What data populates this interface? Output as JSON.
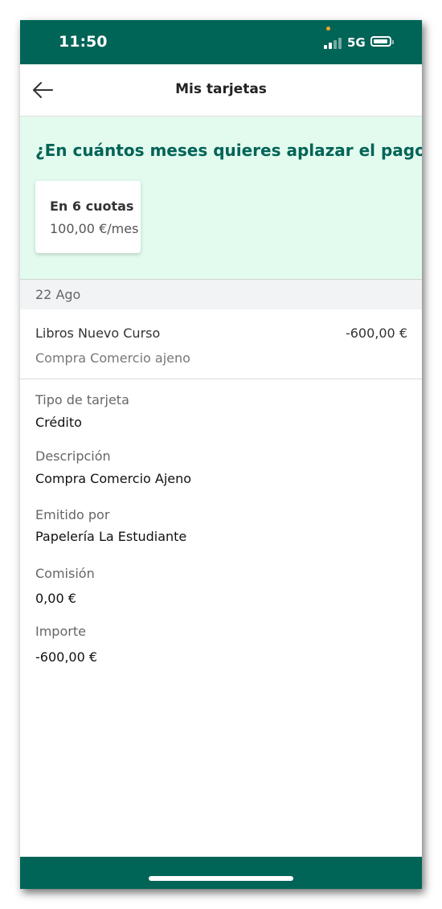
{
  "status": {
    "time": "11:50",
    "network": "5G"
  },
  "header": {
    "title": "Mis tarjetas",
    "back_icon": "arrow-left-icon"
  },
  "promo": {
    "question": "¿En cuántos meses quieres aplazar el pago?",
    "option": {
      "title": "En 6 cuotas",
      "amount": "100,00 €/mes"
    }
  },
  "transaction": {
    "date": "22 Ago",
    "name": "Libros Nuevo Curso",
    "amount": "-600,00 €",
    "type": "Compra Comercio ajeno"
  },
  "details": [
    {
      "label": "Tipo de tarjeta",
      "value": "Crédito"
    },
    {
      "label": "Descripción",
      "value": "Compra Comercio Ajeno"
    },
    {
      "label": "Emitido por",
      "value": "Papelería La Estudiante"
    },
    {
      "label": "Comisión",
      "value": "0,00 €"
    },
    {
      "label": "Importe",
      "value": "-600,00 €"
    }
  ],
  "colors": {
    "brand": "#006457",
    "promo_background": "#e3fbee"
  }
}
